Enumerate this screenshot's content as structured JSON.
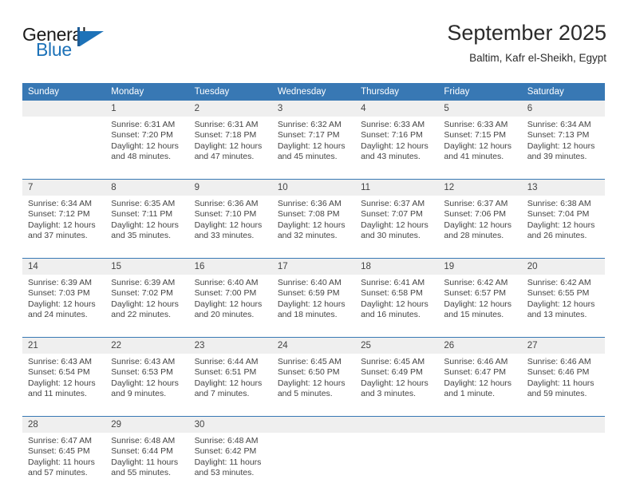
{
  "brand": {
    "name_part1": "General",
    "name_part2": "Blue",
    "logo_icon": "blue-triangle-logo",
    "accent_color": "#1d72b8"
  },
  "header": {
    "month_title": "September 2025",
    "location": "Baltim, Kafr el-Sheikh, Egypt"
  },
  "calendar": {
    "header_bg": "#3878b4",
    "daynum_bg": "#efefef",
    "weekday_headers": [
      "Sunday",
      "Monday",
      "Tuesday",
      "Wednesday",
      "Thursday",
      "Friday",
      "Saturday"
    ],
    "weeks": [
      {
        "days": [
          {
            "num": "",
            "sunrise": "",
            "sunset": "",
            "daylight1": "",
            "daylight2": ""
          },
          {
            "num": "1",
            "sunrise": "Sunrise: 6:31 AM",
            "sunset": "Sunset: 7:20 PM",
            "daylight1": "Daylight: 12 hours",
            "daylight2": "and 48 minutes."
          },
          {
            "num": "2",
            "sunrise": "Sunrise: 6:31 AM",
            "sunset": "Sunset: 7:18 PM",
            "daylight1": "Daylight: 12 hours",
            "daylight2": "and 47 minutes."
          },
          {
            "num": "3",
            "sunrise": "Sunrise: 6:32 AM",
            "sunset": "Sunset: 7:17 PM",
            "daylight1": "Daylight: 12 hours",
            "daylight2": "and 45 minutes."
          },
          {
            "num": "4",
            "sunrise": "Sunrise: 6:33 AM",
            "sunset": "Sunset: 7:16 PM",
            "daylight1": "Daylight: 12 hours",
            "daylight2": "and 43 minutes."
          },
          {
            "num": "5",
            "sunrise": "Sunrise: 6:33 AM",
            "sunset": "Sunset: 7:15 PM",
            "daylight1": "Daylight: 12 hours",
            "daylight2": "and 41 minutes."
          },
          {
            "num": "6",
            "sunrise": "Sunrise: 6:34 AM",
            "sunset": "Sunset: 7:13 PM",
            "daylight1": "Daylight: 12 hours",
            "daylight2": "and 39 minutes."
          }
        ]
      },
      {
        "days": [
          {
            "num": "7",
            "sunrise": "Sunrise: 6:34 AM",
            "sunset": "Sunset: 7:12 PM",
            "daylight1": "Daylight: 12 hours",
            "daylight2": "and 37 minutes."
          },
          {
            "num": "8",
            "sunrise": "Sunrise: 6:35 AM",
            "sunset": "Sunset: 7:11 PM",
            "daylight1": "Daylight: 12 hours",
            "daylight2": "and 35 minutes."
          },
          {
            "num": "9",
            "sunrise": "Sunrise: 6:36 AM",
            "sunset": "Sunset: 7:10 PM",
            "daylight1": "Daylight: 12 hours",
            "daylight2": "and 33 minutes."
          },
          {
            "num": "10",
            "sunrise": "Sunrise: 6:36 AM",
            "sunset": "Sunset: 7:08 PM",
            "daylight1": "Daylight: 12 hours",
            "daylight2": "and 32 minutes."
          },
          {
            "num": "11",
            "sunrise": "Sunrise: 6:37 AM",
            "sunset": "Sunset: 7:07 PM",
            "daylight1": "Daylight: 12 hours",
            "daylight2": "and 30 minutes."
          },
          {
            "num": "12",
            "sunrise": "Sunrise: 6:37 AM",
            "sunset": "Sunset: 7:06 PM",
            "daylight1": "Daylight: 12 hours",
            "daylight2": "and 28 minutes."
          },
          {
            "num": "13",
            "sunrise": "Sunrise: 6:38 AM",
            "sunset": "Sunset: 7:04 PM",
            "daylight1": "Daylight: 12 hours",
            "daylight2": "and 26 minutes."
          }
        ]
      },
      {
        "days": [
          {
            "num": "14",
            "sunrise": "Sunrise: 6:39 AM",
            "sunset": "Sunset: 7:03 PM",
            "daylight1": "Daylight: 12 hours",
            "daylight2": "and 24 minutes."
          },
          {
            "num": "15",
            "sunrise": "Sunrise: 6:39 AM",
            "sunset": "Sunset: 7:02 PM",
            "daylight1": "Daylight: 12 hours",
            "daylight2": "and 22 minutes."
          },
          {
            "num": "16",
            "sunrise": "Sunrise: 6:40 AM",
            "sunset": "Sunset: 7:00 PM",
            "daylight1": "Daylight: 12 hours",
            "daylight2": "and 20 minutes."
          },
          {
            "num": "17",
            "sunrise": "Sunrise: 6:40 AM",
            "sunset": "Sunset: 6:59 PM",
            "daylight1": "Daylight: 12 hours",
            "daylight2": "and 18 minutes."
          },
          {
            "num": "18",
            "sunrise": "Sunrise: 6:41 AM",
            "sunset": "Sunset: 6:58 PM",
            "daylight1": "Daylight: 12 hours",
            "daylight2": "and 16 minutes."
          },
          {
            "num": "19",
            "sunrise": "Sunrise: 6:42 AM",
            "sunset": "Sunset: 6:57 PM",
            "daylight1": "Daylight: 12 hours",
            "daylight2": "and 15 minutes."
          },
          {
            "num": "20",
            "sunrise": "Sunrise: 6:42 AM",
            "sunset": "Sunset: 6:55 PM",
            "daylight1": "Daylight: 12 hours",
            "daylight2": "and 13 minutes."
          }
        ]
      },
      {
        "days": [
          {
            "num": "21",
            "sunrise": "Sunrise: 6:43 AM",
            "sunset": "Sunset: 6:54 PM",
            "daylight1": "Daylight: 12 hours",
            "daylight2": "and 11 minutes."
          },
          {
            "num": "22",
            "sunrise": "Sunrise: 6:43 AM",
            "sunset": "Sunset: 6:53 PM",
            "daylight1": "Daylight: 12 hours",
            "daylight2": "and 9 minutes."
          },
          {
            "num": "23",
            "sunrise": "Sunrise: 6:44 AM",
            "sunset": "Sunset: 6:51 PM",
            "daylight1": "Daylight: 12 hours",
            "daylight2": "and 7 minutes."
          },
          {
            "num": "24",
            "sunrise": "Sunrise: 6:45 AM",
            "sunset": "Sunset: 6:50 PM",
            "daylight1": "Daylight: 12 hours",
            "daylight2": "and 5 minutes."
          },
          {
            "num": "25",
            "sunrise": "Sunrise: 6:45 AM",
            "sunset": "Sunset: 6:49 PM",
            "daylight1": "Daylight: 12 hours",
            "daylight2": "and 3 minutes."
          },
          {
            "num": "26",
            "sunrise": "Sunrise: 6:46 AM",
            "sunset": "Sunset: 6:47 PM",
            "daylight1": "Daylight: 12 hours",
            "daylight2": "and 1 minute."
          },
          {
            "num": "27",
            "sunrise": "Sunrise: 6:46 AM",
            "sunset": "Sunset: 6:46 PM",
            "daylight1": "Daylight: 11 hours",
            "daylight2": "and 59 minutes."
          }
        ]
      },
      {
        "days": [
          {
            "num": "28",
            "sunrise": "Sunrise: 6:47 AM",
            "sunset": "Sunset: 6:45 PM",
            "daylight1": "Daylight: 11 hours",
            "daylight2": "and 57 minutes."
          },
          {
            "num": "29",
            "sunrise": "Sunrise: 6:48 AM",
            "sunset": "Sunset: 6:44 PM",
            "daylight1": "Daylight: 11 hours",
            "daylight2": "and 55 minutes."
          },
          {
            "num": "30",
            "sunrise": "Sunrise: 6:48 AM",
            "sunset": "Sunset: 6:42 PM",
            "daylight1": "Daylight: 11 hours",
            "daylight2": "and 53 minutes."
          },
          {
            "num": "",
            "sunrise": "",
            "sunset": "",
            "daylight1": "",
            "daylight2": ""
          },
          {
            "num": "",
            "sunrise": "",
            "sunset": "",
            "daylight1": "",
            "daylight2": ""
          },
          {
            "num": "",
            "sunrise": "",
            "sunset": "",
            "daylight1": "",
            "daylight2": ""
          },
          {
            "num": "",
            "sunrise": "",
            "sunset": "",
            "daylight1": "",
            "daylight2": ""
          }
        ]
      }
    ]
  }
}
